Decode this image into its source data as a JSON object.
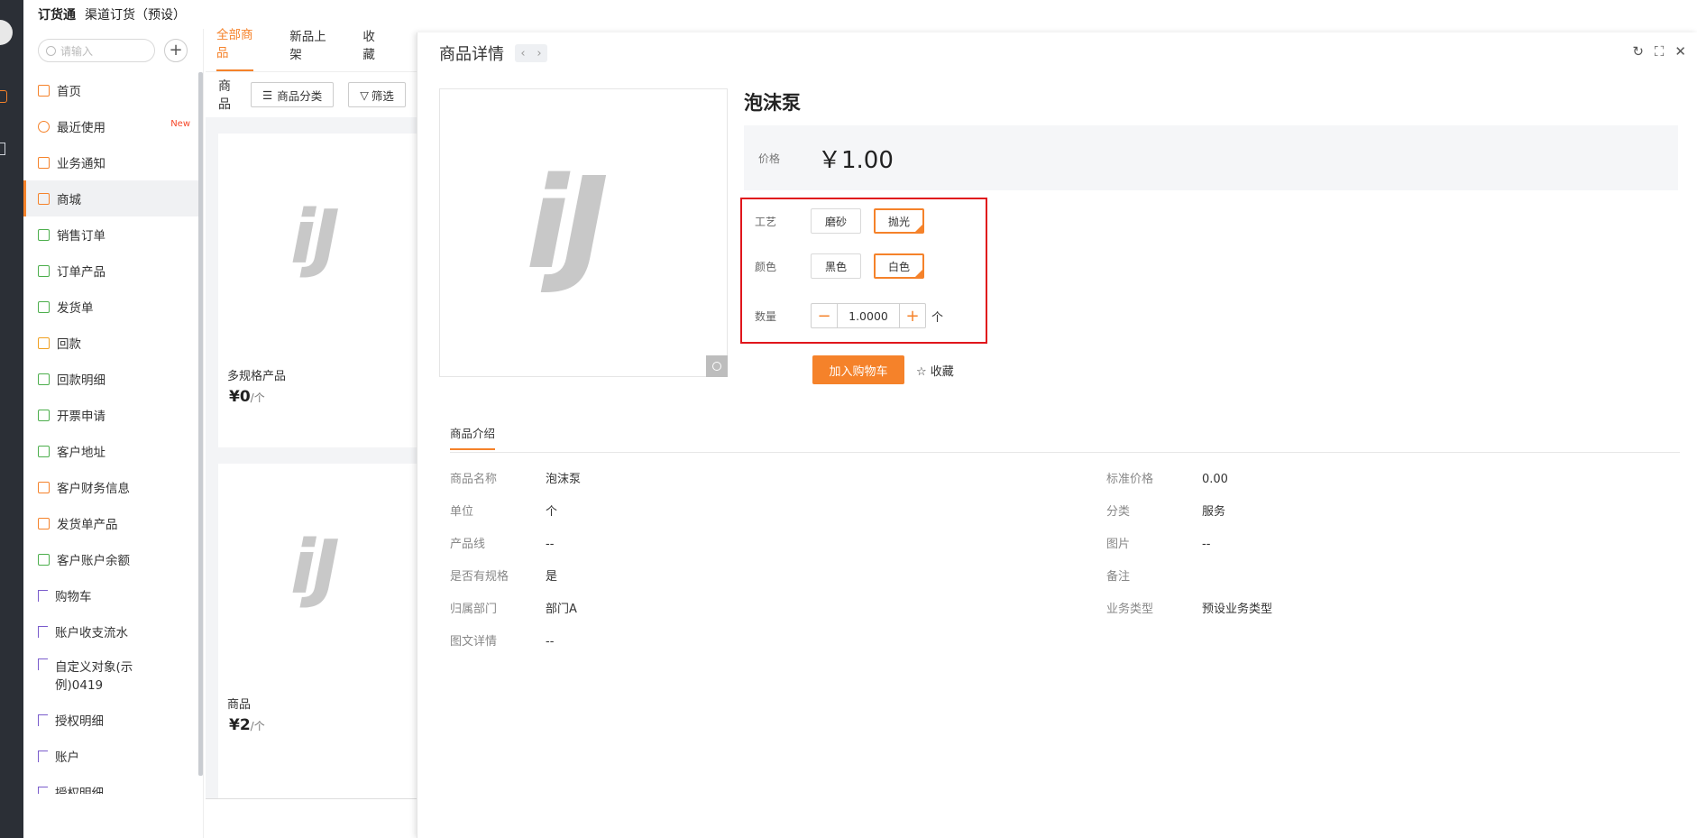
{
  "header": {
    "brand": "订货通",
    "subtitle": "渠道订货（预设）"
  },
  "sidebar": {
    "search_placeholder": "请输入",
    "items": [
      {
        "label": "首页",
        "color": "#f5822a",
        "icon": "home-icon"
      },
      {
        "label": "最近使用",
        "color": "#f5822a",
        "icon": "clock-icon",
        "badge": "New"
      },
      {
        "label": "业务通知",
        "color": "#f5822a",
        "icon": "bell-icon"
      },
      {
        "label": "商城",
        "color": "#f5822a",
        "icon": "bag-icon",
        "active": true
      },
      {
        "label": "销售订单",
        "color": "#4cae4c",
        "icon": "clipboard-icon"
      },
      {
        "label": "订单产品",
        "color": "#4cae4c",
        "icon": "clipboard-icon"
      },
      {
        "label": "发货单",
        "color": "#4cae4c",
        "icon": "clipboard-icon"
      },
      {
        "label": "回款",
        "color": "#f0a020",
        "icon": "wallet-icon"
      },
      {
        "label": "回款明细",
        "color": "#4cae4c",
        "icon": "wallet-icon"
      },
      {
        "label": "开票申请",
        "color": "#4cae4c",
        "icon": "invoice-icon"
      },
      {
        "label": "客户地址",
        "color": "#4cae4c",
        "icon": "address-icon"
      },
      {
        "label": "客户财务信息",
        "color": "#f5822a",
        "icon": "finance-icon"
      },
      {
        "label": "发货单产品",
        "color": "#f5822a",
        "icon": "diamond-icon"
      },
      {
        "label": "客户账户余额",
        "color": "#4cae4c",
        "icon": "card-icon"
      },
      {
        "label": "购物车",
        "color": "#7a5ccc",
        "icon": "flag-icon"
      },
      {
        "label": "账户收支流水",
        "color": "#7a5ccc",
        "icon": "flag-icon"
      },
      {
        "label": "自定义对象(示例)0419",
        "color": "#7a5ccc",
        "icon": "flag-icon"
      },
      {
        "label": "授权明细",
        "color": "#7a5ccc",
        "icon": "flag-icon"
      },
      {
        "label": "账户",
        "color": "#7a5ccc",
        "icon": "flag-icon"
      },
      {
        "label": "授权明细",
        "color": "#7a5ccc",
        "icon": "flag-icon"
      }
    ],
    "collapse_glyph": "«"
  },
  "products": {
    "tabs": [
      "全部商品",
      "新品上架",
      "收藏"
    ],
    "toolbar_label": "商品",
    "category_button": "商品分类",
    "filter_button": "筛选",
    "cards": [
      {
        "name": "多规格产品",
        "price": "¥0",
        "unit": "/个"
      },
      {
        "name": "商品",
        "price": "¥2",
        "unit": "/个"
      }
    ],
    "logo_text": "iJ"
  },
  "detail": {
    "title": "商品详情",
    "product_name": "泡沫泵",
    "price_label": "价格",
    "price_value": "￥1.00",
    "specs": [
      {
        "label": "工艺",
        "options": [
          "磨砂",
          "抛光"
        ],
        "selected": "抛光"
      },
      {
        "label": "颜色",
        "options": [
          "黑色",
          "白色"
        ],
        "selected": "白色"
      }
    ],
    "quantity_label": "数量",
    "quantity_value": "1.0000",
    "quantity_unit": "个",
    "add_to_cart": "加入购物车",
    "favorite": "收藏",
    "intro_tab": "商品介绍",
    "attrs_left": [
      {
        "k": "商品名称",
        "v": "泡沫泵"
      },
      {
        "k": "单位",
        "v": "个"
      },
      {
        "k": "产品线",
        "v": "--"
      },
      {
        "k": "是否有规格",
        "v": "是"
      },
      {
        "k": "归属部门",
        "v": "部门A"
      },
      {
        "k": "图文详情",
        "v": "--"
      }
    ],
    "attrs_right": [
      {
        "k": "标准价格",
        "v": "0.00"
      },
      {
        "k": "分类",
        "v": "服务"
      },
      {
        "k": "图片",
        "v": "--"
      },
      {
        "k": "备注",
        "v": ""
      },
      {
        "k": "业务类型",
        "v": "预设业务类型"
      }
    ]
  },
  "colors": {
    "accent": "#f5822a",
    "highlight_frame": "#e0161c"
  }
}
